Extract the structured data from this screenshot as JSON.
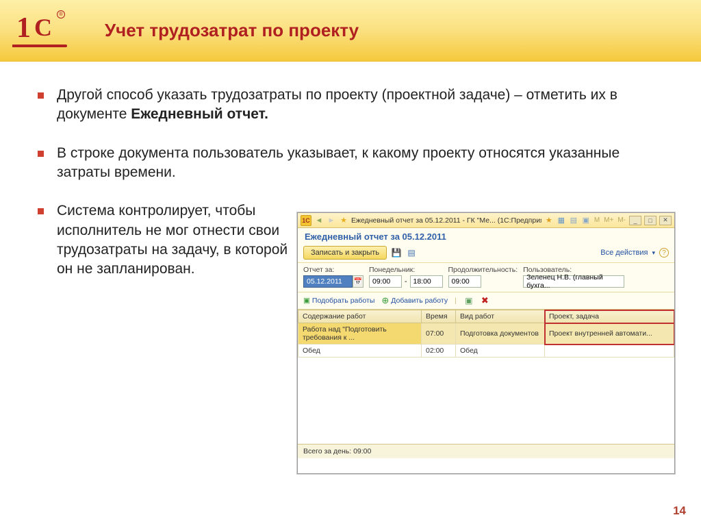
{
  "slide": {
    "title": "Учет трудозатрат по проекту",
    "page_number": "14"
  },
  "bullets": {
    "b1_part1": "Другой способ указать трудозатраты по проекту (проектной задаче) – отметить их в документе ",
    "b1_strong": "Ежедневный отчет.",
    "b2": "В строке документа пользователь указывает, к какому проекту относятся указанные затраты времени.",
    "b3": "Система контролирует, чтобы исполнитель не мог отнести свои трудозатраты на задачу, в которой он не запланирован."
  },
  "app": {
    "titlebar": "Ежедневный отчет за 05.12.2011 - ГК \"Ме...   (1С:Предприятие)",
    "subtitle": "Ежедневный отчет за 05.12.2011",
    "save_close": "Записать и закрыть",
    "all_actions": "Все действия",
    "form": {
      "label_date": "Отчет за:",
      "date": "05.12.2011",
      "label_day": "Понедельник:",
      "time_from": "09:00",
      "time_to": "18:00",
      "label_duration": "Продолжительность:",
      "duration": "09:00",
      "label_user": "Пользователь:",
      "user": "Зеленец Н.В. (главный бухга..."
    },
    "jobs": {
      "pick": "Подобрать работы",
      "add": "Добавить работу"
    },
    "grid": {
      "headers": [
        "Содержание работ",
        "Время",
        "Вид работ",
        "Проект, задача"
      ],
      "rows": [
        {
          "content": "Работа над \"Подготовить требования к ...",
          "time": "07:00",
          "kind": "Подготовка документов",
          "project": "Проект внутренней автомати...",
          "selected": true
        },
        {
          "content": "Обед",
          "time": "02:00",
          "kind": "Обед",
          "project": "",
          "selected": false
        }
      ]
    },
    "footer": "Всего за день: 09:00"
  }
}
